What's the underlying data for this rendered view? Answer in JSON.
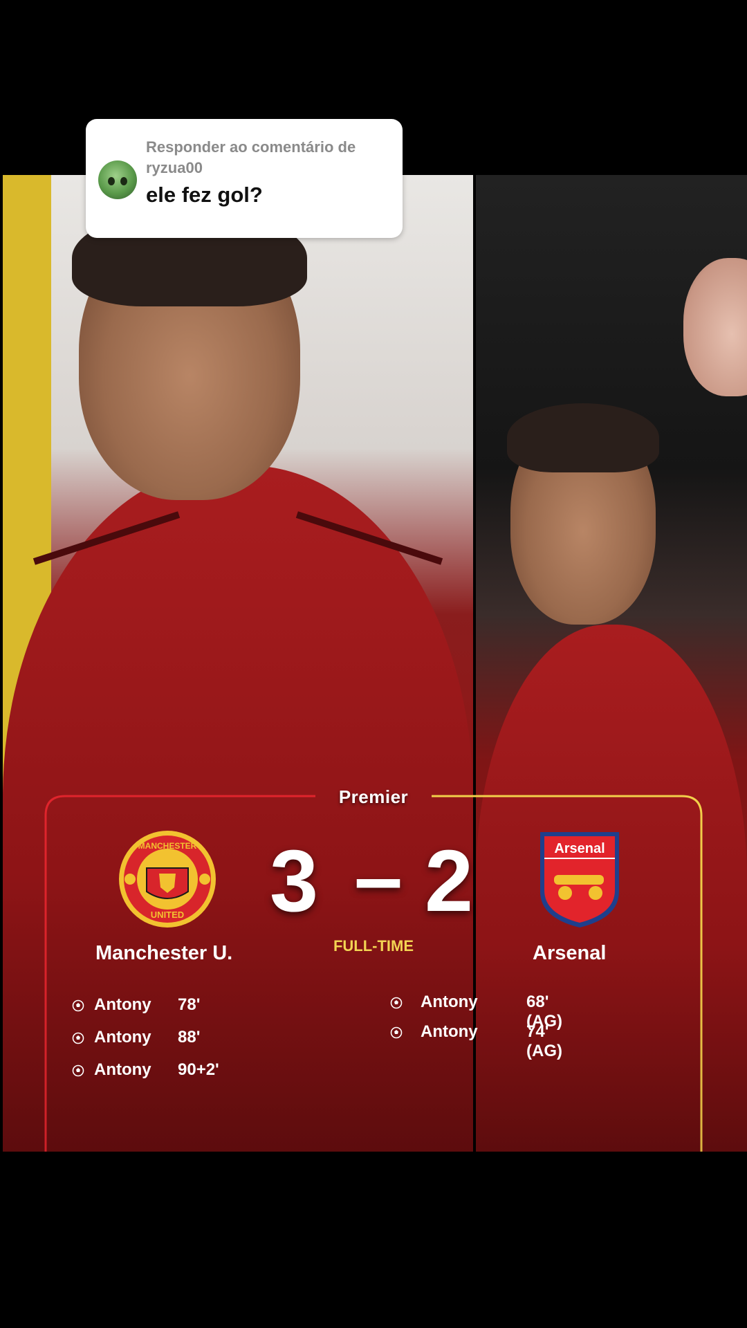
{
  "reply": {
    "heading": "Responder ao comentário de ryzua00",
    "comment": "ele fez gol?",
    "avatar_icon": "frog-avatar-icon"
  },
  "scoreboard": {
    "league": "Premier",
    "status": "FULL-TIME",
    "home": {
      "name": "Manchester U.",
      "score": "3",
      "crest_text_top": "MANCHESTER",
      "crest_text_bottom": "UNITED",
      "scorers": [
        {
          "name": "Antony",
          "minute": "78'"
        },
        {
          "name": "Antony",
          "minute": "88'"
        },
        {
          "name": "Antony",
          "minute": "90+2'"
        }
      ]
    },
    "away": {
      "name": "Arsenal",
      "score": "2",
      "crest_text": "Arsenal",
      "scorers": [
        {
          "name": "Antony",
          "minute": "68' (AG)"
        },
        {
          "name": "Antony",
          "minute": "74' (AG)"
        }
      ]
    },
    "separator": "–"
  },
  "colors": {
    "accent_yellow": "#f3d453",
    "border_red": "#e0242c",
    "border_yellow": "#f2d04a",
    "kit_red": "#a91d1f"
  }
}
